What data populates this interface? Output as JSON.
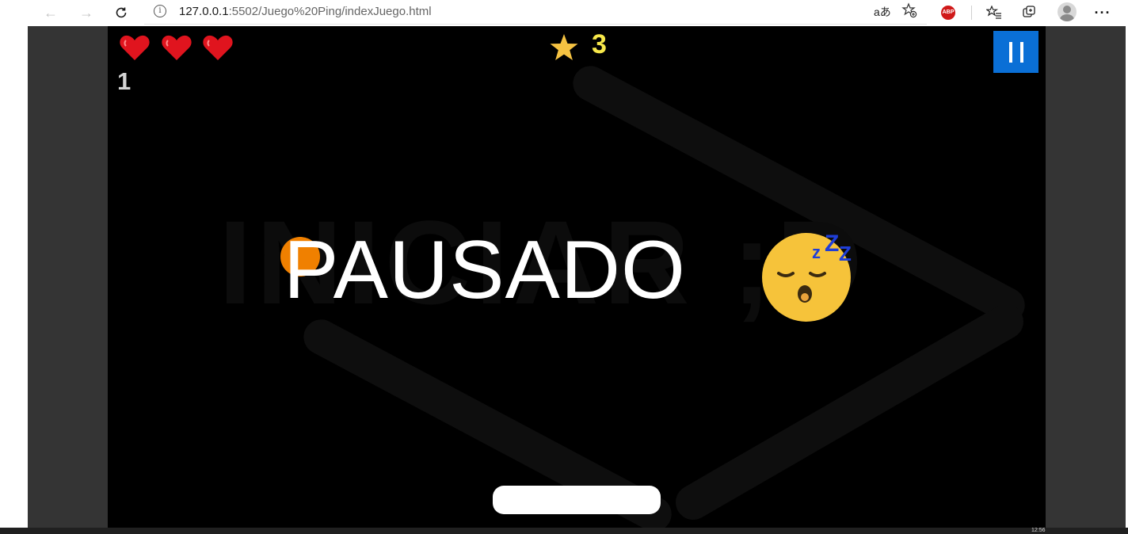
{
  "browser": {
    "url_host": "127.0.0.1",
    "url_rest": ":5502/Juego%20Ping/indexJuego.html",
    "read_aloud_label": "aあ",
    "extension_badge": "ABP"
  },
  "game": {
    "lives": 3,
    "level": "1",
    "score": "3",
    "pause_title": "PAUSADO",
    "background_hint": "INICIAR ;D",
    "colors": {
      "heart": "#e0141e",
      "star": "#f5c242",
      "score": "#f7e84a",
      "pause_button": "#0a6fd6",
      "ball": "#f08000",
      "paddle": "#ffffff"
    },
    "icons": [
      "heart-icon",
      "star-icon",
      "pause-icon",
      "sleeping-face-icon"
    ]
  },
  "taskbar": {
    "clock": "12:56"
  }
}
